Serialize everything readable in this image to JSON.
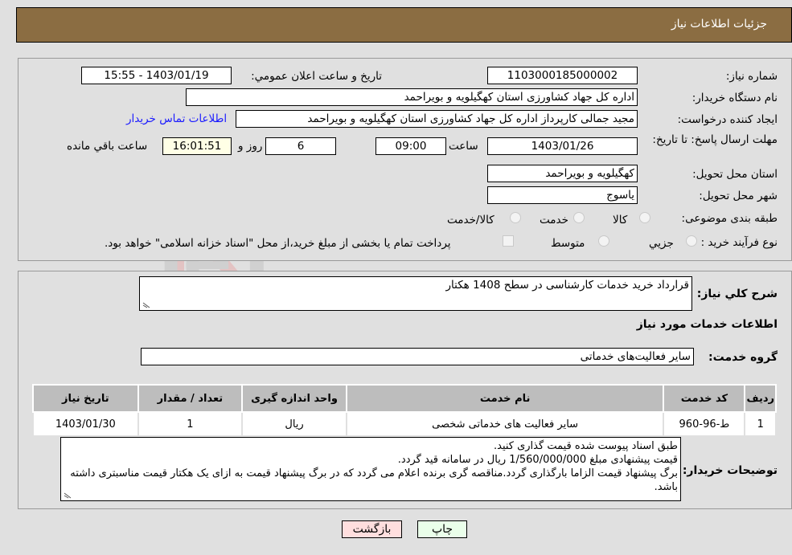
{
  "header": {
    "title": "جزئیات اطلاعات نیاز"
  },
  "details": {
    "need_number_label": "شماره نیاز:",
    "need_number": "1103000185000002",
    "announce_label": "تاریخ و ساعت اعلان عمومي:",
    "announce_value": "1403/01/19 - 15:55",
    "buyer_org_label": "نام دستگاه خریدار:",
    "buyer_org": "اداره کل جهاد کشاورزی استان کهگیلویه و بویراحمد",
    "creator_label": "ایجاد کننده درخواست:",
    "creator": "مجید جمالی کارپرداز اداره کل جهاد کشاورزی استان کهگیلویه و بویراحمد",
    "contact_link": "اطلاعات تماس خریدار",
    "deadline_label": "مهلت ارسال پاسخ: تا تاریخ:",
    "deadline_date": "1403/01/26",
    "time_label": "ساعت",
    "deadline_time": "09:00",
    "days_value": "6",
    "days_label": "روز و",
    "remaining_time": "16:01:51",
    "remaining_label": "ساعت باقي مانده",
    "province_label": "استان محل تحویل:",
    "province": "کهگیلویه و بویراحمد",
    "city_label": "شهر محل تحویل:",
    "city": "یاسوج",
    "category_label": "طبقه بندی موضوعی:",
    "category_options": [
      "کالا",
      "خدمت",
      "کالا/خدمت"
    ],
    "process_label": "نوع فرآیند خرید :",
    "process_options": [
      "جزيي",
      "متوسط"
    ],
    "treasury_note": "پرداخت تمام یا بخشی از مبلغ خرید،از محل \"اسناد خزانه اسلامی\" خواهد بود."
  },
  "need": {
    "summary_label": "شرح کلي نياز:",
    "summary": "قرارداد خرید خدمات کارشناسی در سطح 1408 هکتار",
    "services_title": "اطلاعات خدمات مورد نیاز",
    "service_group_label": "گروه خدمت:",
    "service_group": "سایر فعالیت‌های خدماتی"
  },
  "table": {
    "headers": [
      "ردیف",
      "کد خدمت",
      "نام خدمت",
      "واحد اندازه گیری",
      "تعداد / مقدار",
      "تاریخ نیاز"
    ],
    "rows": [
      [
        "1",
        "ط-96-960",
        "سایر فعالیت های خدماتی شخصی",
        "ریال",
        "1",
        "1403/01/30"
      ]
    ]
  },
  "buyer_notes": {
    "label": "توضیحات خریدار:",
    "lines": [
      "طبق اسناد پیوست شده قیمت گذاری کنید.",
      "قیمت پیشنهادی مبلغ 1/560/000/000 ریال در سامانه قید گردد.",
      "برگ پیشنهاد قیمت الزاما بارگذاری گردد.مناقصه گری برنده اعلام می گردد که در برگ پیشنهاد قیمت به ازای یک هکتار قیمت مناسبتری داشته باشد."
    ]
  },
  "buttons": {
    "print": "چاپ",
    "back": "بازگشت"
  },
  "colors": {
    "header_bg": "#8b6d42",
    "print_bg": "#eaffea",
    "back_bg": "#ffdede",
    "link": "#1a1aff"
  }
}
